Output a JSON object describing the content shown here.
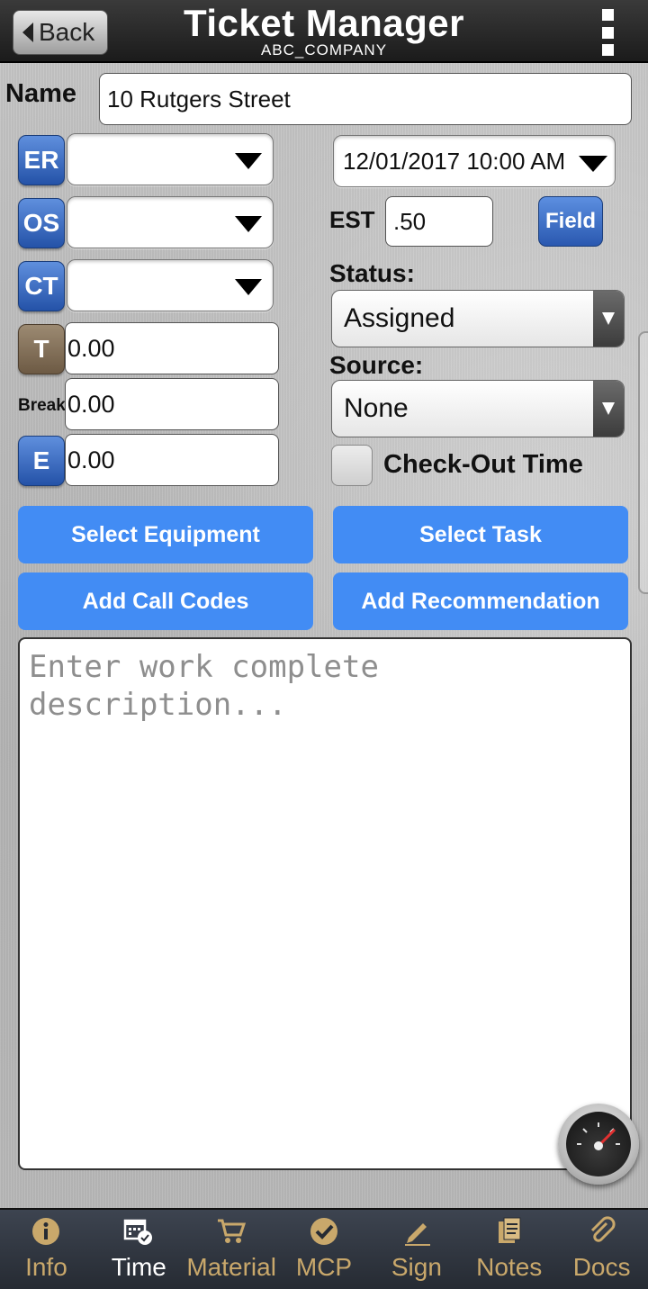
{
  "header": {
    "back_label": "Back",
    "title": "Ticket Manager",
    "company": "ABC_COMPANY",
    "menu_icon": "kebab-menu-icon"
  },
  "form": {
    "name_label": "Name",
    "name_value": "10 Rutgers Street",
    "badges": {
      "er": "ER",
      "os": "OS",
      "ct": "CT",
      "t": "T",
      "e": "E"
    },
    "er_value": "",
    "os_value": "",
    "ct_value": "",
    "t_value": "0.00",
    "break_label": "Break",
    "break_value": "0.00",
    "e_value": "0.00",
    "datetime": "12/01/2017 10:00 AM",
    "est_label": "EST",
    "est_value": ".50",
    "field_label": "Field",
    "status_label": "Status:",
    "status_value": "Assigned",
    "source_label": "Source:",
    "source_value": "None",
    "checkout_label": "Check-Out Time",
    "checkout_checked": false
  },
  "buttons": {
    "select_equipment": "Select Equipment",
    "select_task": "Select Task",
    "add_call_codes": "Add Call Codes",
    "add_recommendation": "Add Recommendation"
  },
  "description": {
    "value": "",
    "placeholder": "Enter work complete description..."
  },
  "nav": {
    "items": [
      {
        "label": "Info",
        "icon": "info-icon",
        "active": false
      },
      {
        "label": "Time",
        "icon": "calendar-clock-icon",
        "active": true
      },
      {
        "label": "Material",
        "icon": "cart-icon",
        "active": false
      },
      {
        "label": "MCP",
        "icon": "check-circle-icon",
        "active": false
      },
      {
        "label": "Sign",
        "icon": "pen-icon",
        "active": false
      },
      {
        "label": "Notes",
        "icon": "notes-icon",
        "active": false
      },
      {
        "label": "Docs",
        "icon": "paperclip-icon",
        "active": false
      }
    ]
  },
  "colors": {
    "accent": "#428cf4",
    "nav_inactive": "#c9a86b",
    "badge_blue": "#2452a8"
  }
}
